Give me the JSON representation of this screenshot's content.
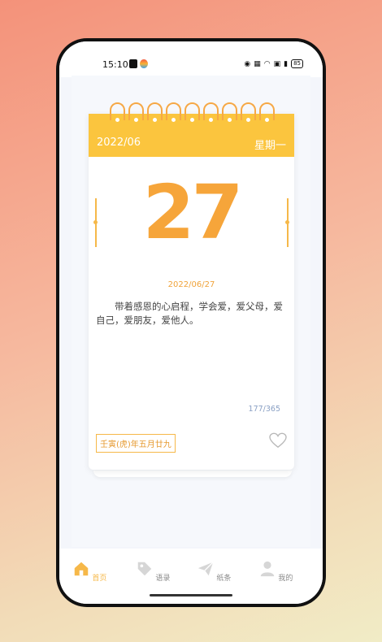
{
  "status_bar": {
    "time": "15:10",
    "battery": "85"
  },
  "calendar": {
    "month": "2022/06",
    "weekday": "星期一",
    "day": "27",
    "date": "2022/06/27",
    "quote": "带着感恩的心启程，学会爱，爱父母，爱自己，爱朋友，爱他人。",
    "day_of_year": "177/365",
    "lunar_date": "壬寅(虎)年五月廿九"
  },
  "tabs": [
    {
      "label": "首页",
      "icon": "home-icon",
      "active": true
    },
    {
      "label": "语录",
      "icon": "tag-icon",
      "active": false
    },
    {
      "label": "纸条",
      "icon": "paper-plane-icon",
      "active": false
    },
    {
      "label": "我的",
      "icon": "user-icon",
      "active": false
    }
  ],
  "colors": {
    "accent": "#fbc53e",
    "orange": "#f6a53a",
    "inactive": "#d6d6d6"
  }
}
